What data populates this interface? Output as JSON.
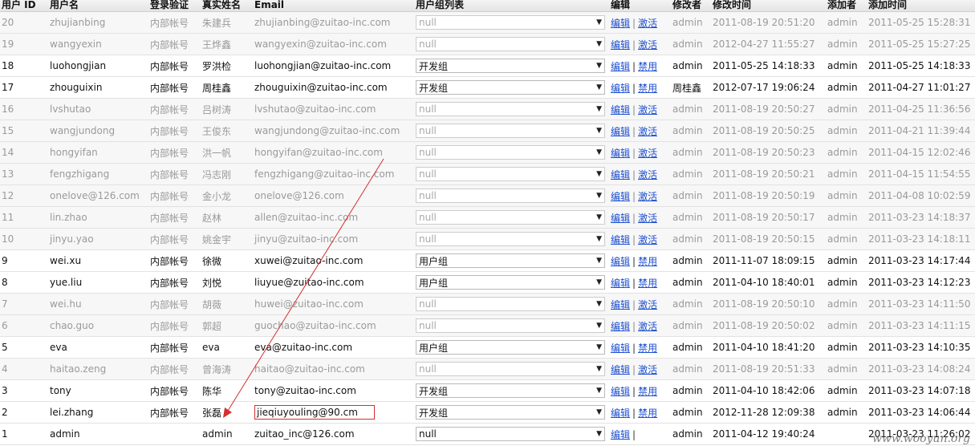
{
  "headers": {
    "id": "用户 ID",
    "username": "用户名",
    "auth": "登录验证",
    "realname": "真实姓名",
    "email": "Email",
    "group": "用户组列表",
    "edit": "编辑",
    "modifier": "修改者",
    "modified": "修改时间",
    "adder": "添加者",
    "added": "添加时间"
  },
  "labels": {
    "edit": "编辑",
    "sep": "|"
  },
  "rows": [
    {
      "id": "20",
      "username": "zhujianbing",
      "auth": "内部帐号",
      "realname": "朱建兵",
      "email": "zhujianbing@zuitao-inc.com",
      "group": "null",
      "action": "激活",
      "modifier": "admin",
      "modified": "2011-08-19 20:51:20",
      "adder": "admin",
      "added": "2011-05-25 15:28:31",
      "status": "disabled"
    },
    {
      "id": "19",
      "username": "wangyexin",
      "auth": "内部帐号",
      "realname": "王烨鑫",
      "email": "wangyexin@zuitao-inc.com",
      "group": "null",
      "action": "激活",
      "modifier": "admin",
      "modified": "2012-04-27 11:55:27",
      "adder": "admin",
      "added": "2011-05-25 15:27:25",
      "status": "disabled"
    },
    {
      "id": "18",
      "username": "luohongjian",
      "auth": "内部帐号",
      "realname": "罗洪检",
      "email": "luohongjian@zuitao-inc.com",
      "group": "开发组",
      "action": "禁用",
      "modifier": "admin",
      "modified": "2011-05-25 14:18:33",
      "adder": "admin",
      "added": "2011-05-25 14:18:33",
      "status": "enabled"
    },
    {
      "id": "17",
      "username": "zhouguixin",
      "auth": "内部帐号",
      "realname": "周桂鑫",
      "email": "zhouguixin@zuitao-inc.com",
      "group": "开发组",
      "action": "禁用",
      "modifier": "周桂鑫",
      "modified": "2012-07-17 19:06:24",
      "adder": "admin",
      "added": "2011-04-27 11:01:27",
      "status": "enabled"
    },
    {
      "id": "16",
      "username": "lvshutao",
      "auth": "内部帐号",
      "realname": "吕树涛",
      "email": "lvshutao@zuitao-inc.com",
      "group": "null",
      "action": "激活",
      "modifier": "admin",
      "modified": "2011-08-19 20:50:27",
      "adder": "admin",
      "added": "2011-04-25 11:36:56",
      "status": "disabled"
    },
    {
      "id": "15",
      "username": "wangjundong",
      "auth": "内部帐号",
      "realname": "王俊东",
      "email": "wangjundong@zuitao-inc.com",
      "group": "null",
      "action": "激活",
      "modifier": "admin",
      "modified": "2011-08-19 20:50:25",
      "adder": "admin",
      "added": "2011-04-21 11:39:44",
      "status": "disabled"
    },
    {
      "id": "14",
      "username": "hongyifan",
      "auth": "内部帐号",
      "realname": "洪一帆",
      "email": "hongyifan@zuitao-inc.com",
      "group": "null",
      "action": "激活",
      "modifier": "admin",
      "modified": "2011-08-19 20:50:23",
      "adder": "admin",
      "added": "2011-04-15 12:02:46",
      "status": "disabled"
    },
    {
      "id": "13",
      "username": "fengzhigang",
      "auth": "内部帐号",
      "realname": "冯志刚",
      "email": "fengzhigang@zuitao-inc.com",
      "group": "null",
      "action": "激活",
      "modifier": "admin",
      "modified": "2011-08-19 20:50:21",
      "adder": "admin",
      "added": "2011-04-15 11:54:55",
      "status": "disabled"
    },
    {
      "id": "12",
      "username": "onelove@126.com",
      "auth": "内部帐号",
      "realname": "金小龙",
      "email": "onelove@126.com",
      "group": "null",
      "action": "激活",
      "modifier": "admin",
      "modified": "2011-08-19 20:50:19",
      "adder": "admin",
      "added": "2011-04-08 10:02:59",
      "status": "disabled"
    },
    {
      "id": "11",
      "username": "lin.zhao",
      "auth": "内部帐号",
      "realname": "赵林",
      "email": "allen@zuitao-inc.com",
      "group": "null",
      "action": "激活",
      "modifier": "admin",
      "modified": "2011-08-19 20:50:17",
      "adder": "admin",
      "added": "2011-03-23 14:18:37",
      "status": "disabled"
    },
    {
      "id": "10",
      "username": "jinyu.yao",
      "auth": "内部帐号",
      "realname": "姚金宇",
      "email": "jinyu@zuitao-inc.com",
      "group": "null",
      "action": "激活",
      "modifier": "admin",
      "modified": "2011-08-19 20:50:15",
      "adder": "admin",
      "added": "2011-03-23 14:18:11",
      "status": "disabled"
    },
    {
      "id": "9",
      "username": "wei.xu",
      "auth": "内部帐号",
      "realname": "徐微",
      "email": "xuwei@zuitao-inc.com",
      "group": "用户组",
      "action": "禁用",
      "modifier": "admin",
      "modified": "2011-11-07 18:09:15",
      "adder": "admin",
      "added": "2011-03-23 14:17:44",
      "status": "enabled"
    },
    {
      "id": "8",
      "username": "yue.liu",
      "auth": "内部帐号",
      "realname": "刘悦",
      "email": "liuyue@zuitao-inc.com",
      "group": "用户组",
      "action": "禁用",
      "modifier": "admin",
      "modified": "2011-04-10 18:40:01",
      "adder": "admin",
      "added": "2011-03-23 14:12:23",
      "status": "enabled"
    },
    {
      "id": "7",
      "username": "wei.hu",
      "auth": "内部帐号",
      "realname": "胡薇",
      "email": "huwei@zuitao-inc.com",
      "group": "null",
      "action": "激活",
      "modifier": "admin",
      "modified": "2011-08-19 20:50:10",
      "adder": "admin",
      "added": "2011-03-23 14:11:50",
      "status": "disabled"
    },
    {
      "id": "6",
      "username": "chao.guo",
      "auth": "内部帐号",
      "realname": "郭超",
      "email": "guochao@zuitao-inc.com",
      "group": "null",
      "action": "激活",
      "modifier": "admin",
      "modified": "2011-08-19 20:50:02",
      "adder": "admin",
      "added": "2011-03-23 14:11:15",
      "status": "disabled"
    },
    {
      "id": "5",
      "username": "eva",
      "auth": "内部帐号",
      "realname": "eva",
      "email": "eva@zuitao-inc.com",
      "group": "用户组",
      "action": "禁用",
      "modifier": "admin",
      "modified": "2011-04-10 18:41:20",
      "adder": "admin",
      "added": "2011-03-23 14:10:35",
      "status": "enabled"
    },
    {
      "id": "4",
      "username": "haitao.zeng",
      "auth": "内部帐号",
      "realname": "曾海涛",
      "email": "haitao@zuitao-inc.com",
      "group": "null",
      "action": "激活",
      "modifier": "admin",
      "modified": "2011-08-19 20:51:33",
      "adder": "admin",
      "added": "2011-03-23 14:08:24",
      "status": "disabled"
    },
    {
      "id": "3",
      "username": "tony",
      "auth": "内部帐号",
      "realname": "陈华",
      "email": "tony@zuitao-inc.com",
      "group": "开发组",
      "action": "禁用",
      "modifier": "admin",
      "modified": "2011-04-10 18:42:06",
      "adder": "admin",
      "added": "2011-03-23 14:07:18",
      "status": "enabled"
    },
    {
      "id": "2",
      "username": "lei.zhang",
      "auth": "内部帐号",
      "realname": "张磊",
      "email": "jieqiuyouling@90.cm",
      "group": "开发组",
      "action": "禁用",
      "modifier": "admin",
      "modified": "2012-11-28 12:09:38",
      "adder": "admin",
      "added": "2011-03-23 14:06:44",
      "status": "enabled",
      "highlight": true
    },
    {
      "id": "1",
      "username": "admin",
      "auth": "",
      "realname": "admin",
      "email": "zuitao_inc@126.com",
      "group": "null",
      "action": "",
      "modifier": "admin",
      "modified": "2011-04-12 19:40:24",
      "adder": "",
      "added": "2011-03-23 11:26:02",
      "status": "enabled"
    }
  ],
  "watermark": "www.wooyun.org",
  "colors": {
    "link": "#1d4fd1",
    "annotation": "#d43030",
    "disabled_text": "#9a9a9a"
  }
}
